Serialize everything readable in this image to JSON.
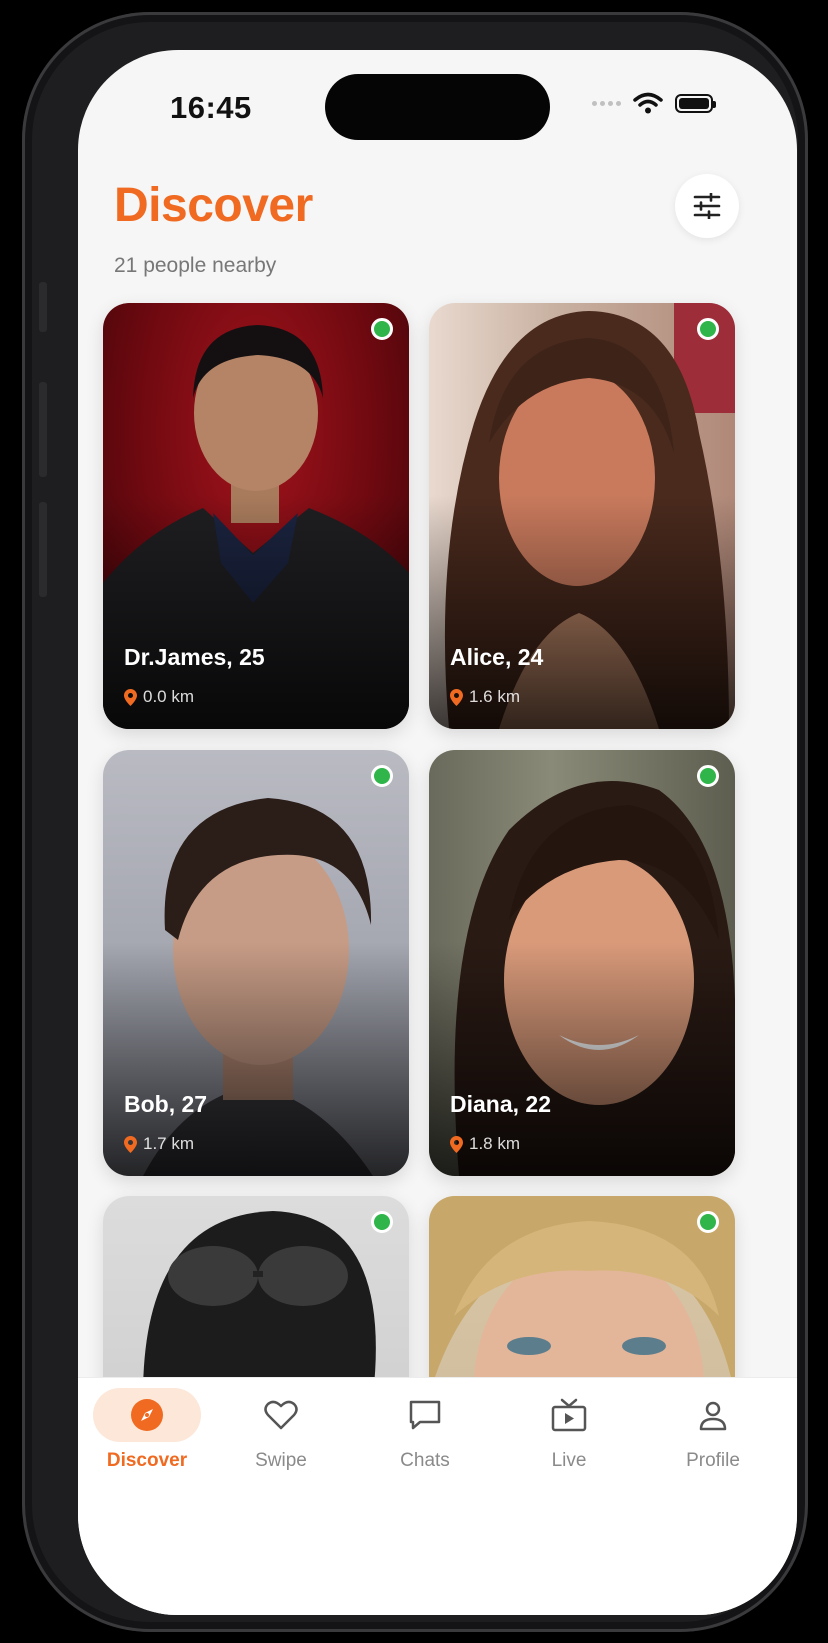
{
  "status_bar": {
    "time": "16:45"
  },
  "header": {
    "title": "Discover",
    "subtitle": "21 people nearby",
    "filter_icon": "sliders-icon"
  },
  "colors": {
    "accent": "#f06a21",
    "online": "#2fb54a",
    "background": "#f6f6f6"
  },
  "profiles": [
    {
      "name_age": "Dr.James, 25",
      "distance": "0.0 km",
      "online": true
    },
    {
      "name_age": "Alice, 24",
      "distance": "1.6 km",
      "online": true
    },
    {
      "name_age": "Bob, 27",
      "distance": "1.7 km",
      "online": true
    },
    {
      "name_age": "Diana, 22",
      "distance": "1.8 km",
      "online": true
    },
    {
      "name_age": "",
      "distance": "",
      "online": true
    },
    {
      "name_age": "",
      "distance": "",
      "online": true
    }
  ],
  "tabs": [
    {
      "label": "Discover",
      "icon": "compass-icon",
      "active": true
    },
    {
      "label": "Swipe",
      "icon": "heart-icon",
      "active": false
    },
    {
      "label": "Chats",
      "icon": "chat-icon",
      "active": false
    },
    {
      "label": "Live",
      "icon": "tv-icon",
      "active": false
    },
    {
      "label": "Profile",
      "icon": "person-icon",
      "active": false
    }
  ]
}
